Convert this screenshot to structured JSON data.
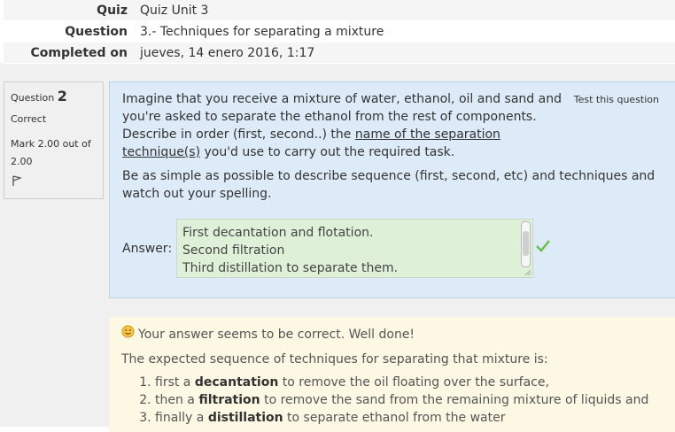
{
  "summary": {
    "rows": [
      {
        "label": "Quiz",
        "value": "Quiz Unit 3"
      },
      {
        "label": "Question",
        "value": "3.- Techniques for separating a mixture"
      },
      {
        "label": "Completed on",
        "value": "jueves, 14 enero 2016, 1:17"
      }
    ]
  },
  "question_info": {
    "prefix": "Question",
    "number": "2",
    "state": "Correct",
    "grade": "Mark 2.00 out of 2.00",
    "flag_icon": "flag-icon"
  },
  "formulation": {
    "test_link": "Test this question",
    "text1_a": "Imagine that you receive a mixture of water, ethanol, oil and sand and you're asked to separate the ethanol from the rest of components. Describe in order (first, second..) the ",
    "text1_u": "name of the separation technique(s)",
    "text1_b": " you'd use to carry out the required task.",
    "text2": "Be as simple as possible to describe sequence (first, second, etc) and techniques and watch out your spelling.",
    "answer_label": "Answer:",
    "answer_lines": [
      "First decantation and flotation.",
      "Second filtration",
      "Third distillation to separate them."
    ],
    "correct_icon": "check-icon",
    "correct_color": "#5cb85c"
  },
  "feedback": {
    "icon": "smiley-icon",
    "line1": "Your answer seems to be correct. Well done!",
    "line2": "The expected sequence of techniques for separating that mixture is:",
    "items": [
      {
        "pre": "first a ",
        "bold": "decantation",
        "post": " to remove the oil floating over the surface,"
      },
      {
        "pre": "then a ",
        "bold": "filtration",
        "post": " to remove the sand from the remaining mixture of liquids and"
      },
      {
        "pre": "finally a ",
        "bold": "distillation",
        "post": " to separate ethanol from the water"
      }
    ]
  }
}
